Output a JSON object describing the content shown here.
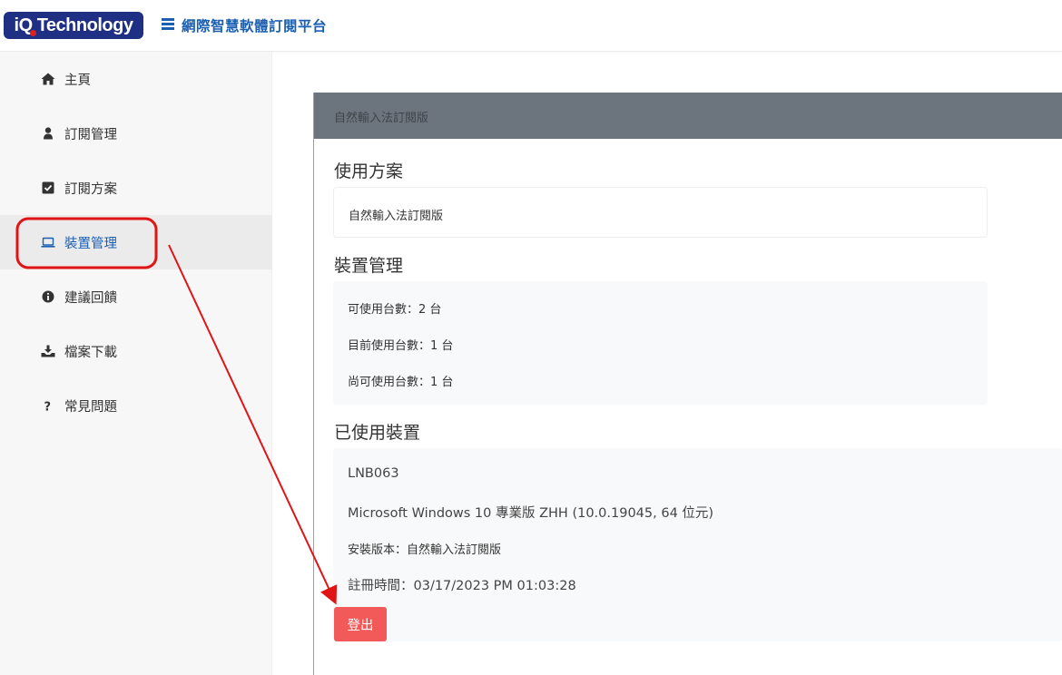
{
  "header": {
    "logo_text": "iQ Technology",
    "platform_title": "網際智慧軟體訂閱平台"
  },
  "sidebar": {
    "items": [
      {
        "label": "主頁",
        "icon": "home-icon"
      },
      {
        "label": "訂閱管理",
        "icon": "user-icon"
      },
      {
        "label": "訂閱方案",
        "icon": "checkbox-icon"
      },
      {
        "label": "裝置管理",
        "icon": "laptop-icon",
        "active": true
      },
      {
        "label": "建議回饋",
        "icon": "info-icon"
      },
      {
        "label": "檔案下載",
        "icon": "download-icon"
      },
      {
        "label": "常見問題",
        "icon": "question-icon"
      }
    ]
  },
  "card": {
    "header_title": "自然輸入法訂閱版",
    "plan": {
      "title": "使用方案",
      "value": "自然輸入法訂閱版"
    },
    "device_management": {
      "title": "裝置管理",
      "lines": [
        "可使用台數：2 台",
        "目前使用台數：1 台",
        "尚可使用台數：1 台"
      ]
    },
    "used_devices": {
      "title": "已使用裝置",
      "device_name": "LNB063",
      "os": "Microsoft Windows 10 專業版 ZHH (10.0.19045, 64 位元)",
      "install_version": "安裝版本：自然輸入法訂閱版",
      "register_time": "註冊時間：03/17/2023 PM 01:03:28",
      "logout_label": "登出"
    }
  },
  "colors": {
    "brand": "#1f2f84",
    "accent": "#1b5fb3",
    "card_header": "#6c757d",
    "logout": "#f25a5a",
    "annotation": "#e01414"
  }
}
